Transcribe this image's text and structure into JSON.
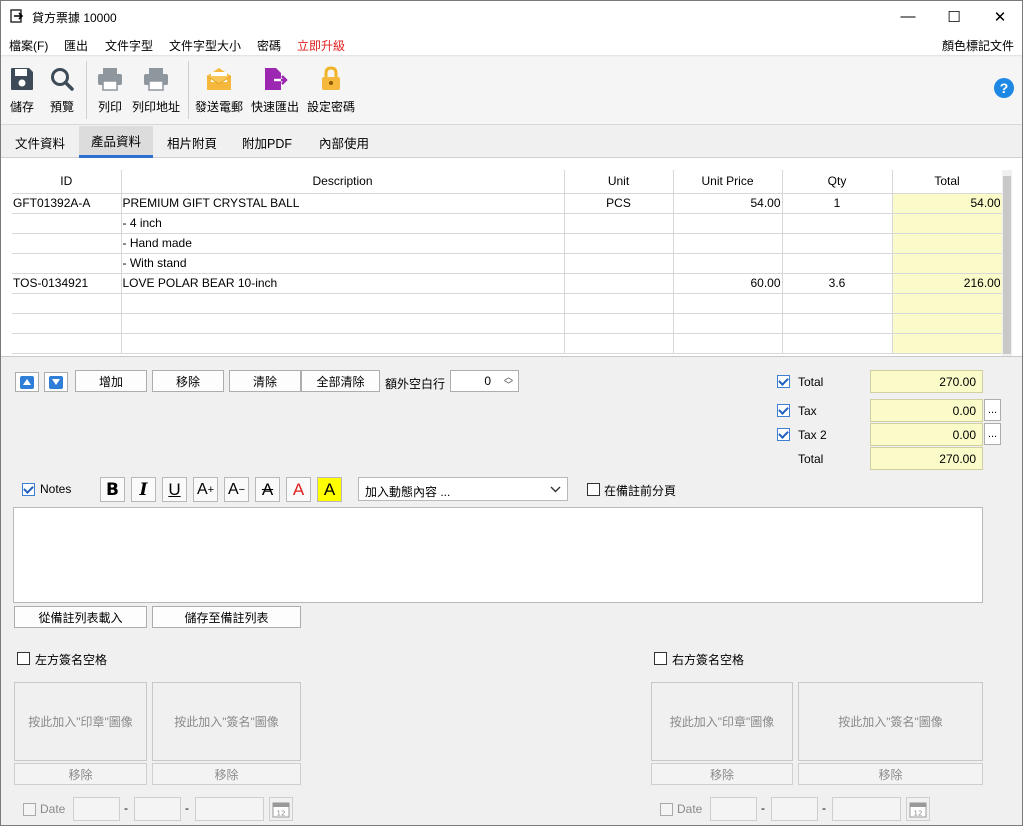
{
  "window": {
    "title": "貸方票據 10000",
    "minimize": "—",
    "maximize": "☐",
    "close": "✕"
  },
  "menu": {
    "items": [
      "檔案(F)",
      "匯出",
      "文件字型",
      "文件字型大小",
      "密碼",
      "立即升級"
    ],
    "right": "顏色標記文件",
    "upgrade_color": "#e02020"
  },
  "toolbar": {
    "save": "儲存",
    "preview": "預覽",
    "print": "列印",
    "print_address": "列印地址",
    "send_email": "發送電郵",
    "quick_export": "快速匯出",
    "set_password": "設定密碼",
    "help": "?"
  },
  "tabs": [
    "文件資料",
    "產品資料",
    "相片附頁",
    "附加PDF",
    "內部使用"
  ],
  "grid": {
    "headers": [
      "ID",
      "Description",
      "Unit",
      "Unit Price",
      "Qty",
      "Total"
    ],
    "rows": [
      [
        "GFT01392A-A",
        "PREMIUM GIFT CRYSTAL BALL",
        "PCS",
        "54.00",
        "1",
        "54.00"
      ],
      [
        "",
        "- 4 inch",
        "",
        "",
        "",
        ""
      ],
      [
        "",
        "- Hand made",
        "",
        "",
        "",
        ""
      ],
      [
        "",
        "- With stand",
        "",
        "",
        "",
        ""
      ],
      [
        "TOS-0134921",
        "LOVE POLAR BEAR 10-inch",
        "",
        "60.00",
        "3.6",
        "216.00"
      ],
      [
        "",
        "",
        "",
        "",
        "",
        ""
      ],
      [
        "",
        "",
        "",
        "",
        "",
        ""
      ],
      [
        "",
        "",
        "",
        "",
        "",
        ""
      ]
    ]
  },
  "actions": {
    "add": "增加",
    "remove": "移除",
    "clear": "清除",
    "clear_all": "全部清除",
    "extra_blank_label": "額外空白行",
    "extra_blank_value": "0"
  },
  "totals": {
    "total_label": "Total",
    "total_value": "270.00",
    "tax_label": "Tax",
    "tax_value": "0.00",
    "tax2_label": "Tax 2",
    "tax2_value": "0.00",
    "grand_label": "Total",
    "grand_value": "270.00",
    "more": "..."
  },
  "notes": {
    "label": "Notes",
    "dynamic_placeholder": "加入動態內容 ...",
    "page_break_label": "在備註前分頁",
    "load_button": "從備註列表載入",
    "save_button": "儲存至備註列表"
  },
  "signatures": {
    "left_label": "左方簽名空格",
    "right_label": "右方簽名空格",
    "stamp_text": "按此加入\"印章\"圖像",
    "sign_text": "按此加入\"簽名\"圖像",
    "remove": "移除",
    "date_label": "Date",
    "dash": "-",
    "cal_day": "12"
  }
}
